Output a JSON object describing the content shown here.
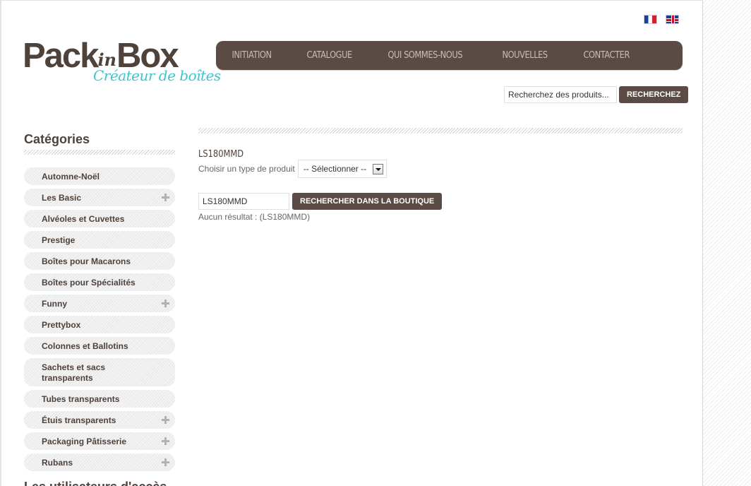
{
  "languages": [
    {
      "name": "fr-flag-icon"
    },
    {
      "name": "en-flag-icon"
    }
  ],
  "logo": {
    "main_before": "Pack",
    "main_mid": "in",
    "main_after": "Box",
    "tagline": "Créateur de boîtes"
  },
  "nav": {
    "items": [
      "INITIATION",
      "CATALOGUE",
      "QUI SOMMES-NOUS",
      "NOUVELLES",
      "CONTACTER"
    ]
  },
  "header_search": {
    "value": "Recherchez des produits...",
    "button": "RECHERCHEZ"
  },
  "sidebar": {
    "title": "Catégories",
    "items": [
      {
        "label": "Automne-Noël",
        "expand": false
      },
      {
        "label": "Les Basic",
        "expand": true
      },
      {
        "label": "Alvéoles et Cuvettes",
        "expand": false
      },
      {
        "label": "Prestige",
        "expand": false
      },
      {
        "label": "Boîtes pour Macarons",
        "expand": false
      },
      {
        "label": "Boîtes pour Spécialités",
        "expand": false
      },
      {
        "label": "Funny",
        "expand": true
      },
      {
        "label": "Prettybox",
        "expand": false
      },
      {
        "label": "Colonnes et Ballotins",
        "expand": false
      },
      {
        "label": "Sachets et sacs transparents",
        "expand": false
      },
      {
        "label": "Tubes transparents",
        "expand": false
      },
      {
        "label": "Étuis transparents",
        "expand": true
      },
      {
        "label": "Packaging Pâtisserie",
        "expand": true
      },
      {
        "label": "Rubans",
        "expand": true
      }
    ],
    "next_title": "Les utilisateurs d'accès"
  },
  "main": {
    "title": "LS180MMD",
    "choose_label": "Choisir un type de produit",
    "select_value": "-- Sélectionner --",
    "search_value": "LS180MMD",
    "search_button": "RECHERCHER DANS LA BOUTIQUE",
    "no_result": "Aucun résultat : (LS180MMD)"
  },
  "colors": {
    "brand_brown": "#5a4b45",
    "brand_cyan": "#3ec4cf"
  }
}
